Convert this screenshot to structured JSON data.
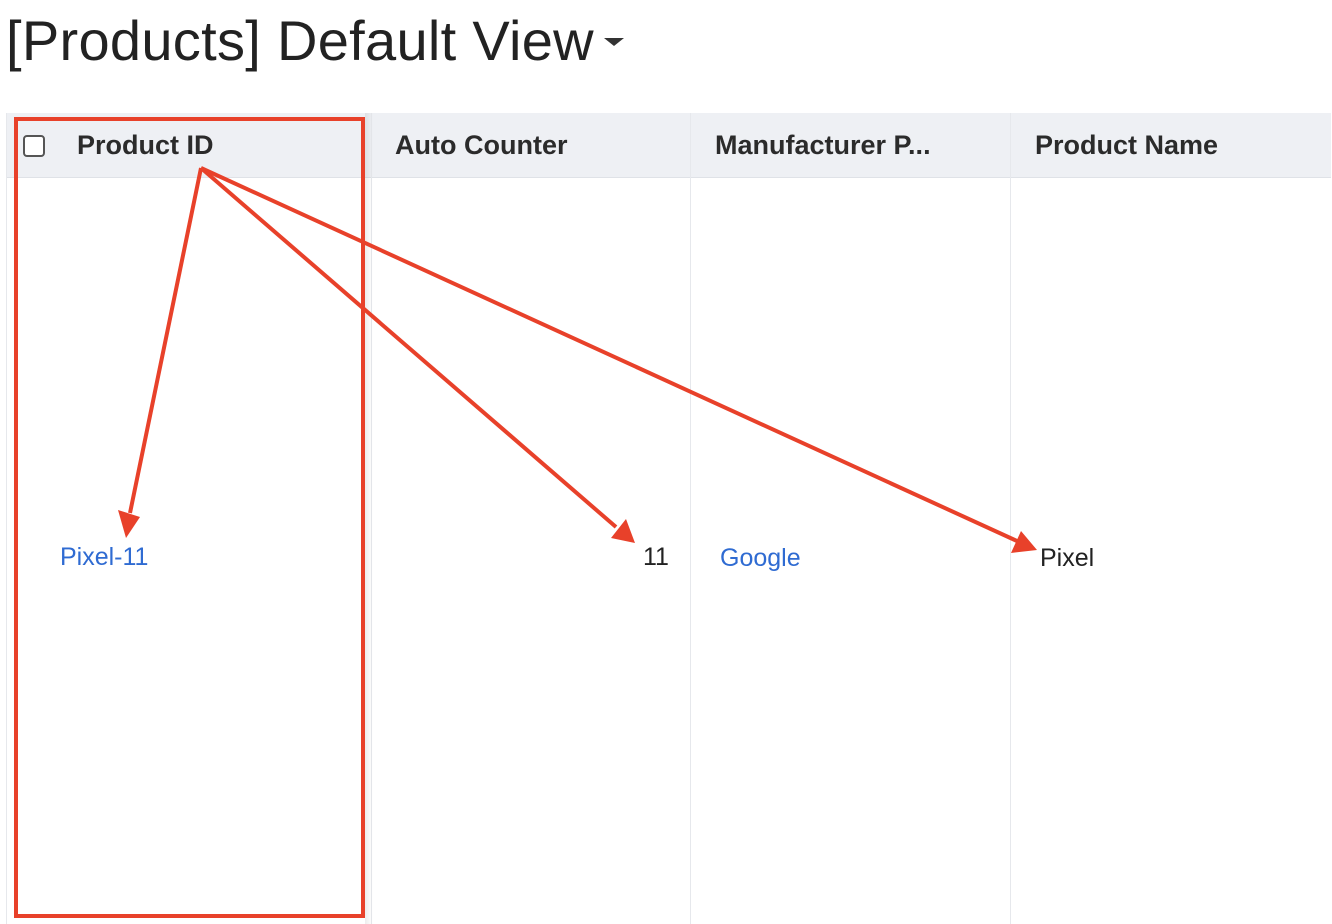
{
  "view": {
    "title": "[Products] Default View"
  },
  "table": {
    "columns": [
      {
        "label": "Product ID"
      },
      {
        "label": "Auto Counter"
      },
      {
        "label": "Manufacturer P..."
      },
      {
        "label": "Product Name"
      }
    ],
    "rows": [
      {
        "product_id": "Pixel-11",
        "auto_counter": "11",
        "manufacturer": "Google",
        "product_name": "Pixel"
      }
    ]
  },
  "annotation": {
    "color": "#e8412a"
  },
  "icons": {
    "view_menu": "caret-down-icon",
    "select_all": "checkbox-icon"
  }
}
